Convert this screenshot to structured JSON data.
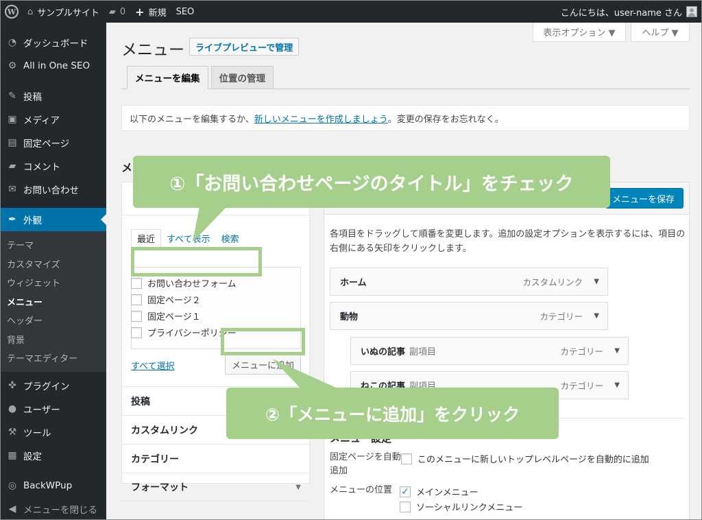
{
  "adminbar": {
    "site_name": "サンプルサイト",
    "comments_count": "0",
    "new_label": "新規",
    "seo_label": "SEO",
    "greeting": "こんにちは、user-name さん"
  },
  "sidebar": {
    "items": [
      {
        "label": "ダッシュボード",
        "icon": "dashboard-icon"
      },
      {
        "label": "All in One SEO",
        "icon": "gear-icon"
      },
      {
        "label": "投稿",
        "icon": "pin-icon"
      },
      {
        "label": "メディア",
        "icon": "media-icon"
      },
      {
        "label": "固定ページ",
        "icon": "page-icon"
      },
      {
        "label": "コメント",
        "icon": "comment-icon"
      },
      {
        "label": "お問い合わせ",
        "icon": "mail-icon"
      },
      {
        "label": "外観",
        "icon": "brush-icon"
      }
    ],
    "submenu": [
      "テーマ",
      "カスタマイズ",
      "ウィジェット",
      "メニュー",
      "ヘッダー",
      "背景",
      "テーマエディター"
    ],
    "items2": [
      {
        "label": "プラグイン",
        "icon": "plugin-icon"
      },
      {
        "label": "ユーザー",
        "icon": "user-icon"
      },
      {
        "label": "ツール",
        "icon": "wrench-icon"
      },
      {
        "label": "設定",
        "icon": "settings-icon"
      },
      {
        "label": "BackWPup",
        "icon": "backup-icon"
      },
      {
        "label": "メニューを閉じる",
        "icon": "collapse-icon"
      }
    ]
  },
  "header": {
    "screen_options": "表示オプション ▼",
    "help": "ヘルプ ▼",
    "title": "メニュー",
    "live_preview": "ライブプレビューで管理"
  },
  "tabs": [
    "メニューを編集",
    "位置の管理"
  ],
  "notice": {
    "prefix": "以下のメニューを編集するか、",
    "link": "新しいメニューを作成しましょう",
    "suffix": "。変更の保存をお忘れなく。"
  },
  "section_letter": "メ",
  "pages_panel": {
    "tabs": [
      "最近",
      "すべて表示",
      "検索"
    ],
    "items": [
      "お問い合わせフォーム",
      "固定ページ２",
      "固定ページ１",
      "プライバシーポリシー"
    ],
    "select_all": "すべて選択",
    "add_button": "メニューに追加"
  },
  "accordion": [
    "投稿",
    "カスタムリンク",
    "カテゴリー",
    "フォーマット"
  ],
  "editor": {
    "save_button": "メニューを保存",
    "help": "各項目をドラッグして順番を変更します。追加の設定オプションを表示するには、項目の右側にある矢印をクリックします。",
    "items": [
      {
        "title": "ホーム",
        "sub": "",
        "type": "カスタムリンク"
      },
      {
        "title": "動物",
        "sub": "",
        "type": "カテゴリー"
      },
      {
        "title": "いぬの記事",
        "sub": "副項目",
        "type": "カテゴリー"
      },
      {
        "title": "ねこの記事",
        "sub": "副項目",
        "type": "カテゴリー"
      }
    ],
    "settings_title": "メニュー設定",
    "auto_add_label": "固定ページを自動追加",
    "auto_add_option": "このメニューに新しいトップレベルページを自動的に追加",
    "location_label": "メニューの位置",
    "locations": [
      {
        "label": "メインメニュー",
        "checked": true
      },
      {
        "label": "ソーシャルリンクメニュー",
        "checked": false
      }
    ]
  },
  "callouts": {
    "step1": "①「お問い合わせページのタイトル」をチェック",
    "step2": "②「メニューに追加」をクリック"
  },
  "colors": {
    "adminbar": "#23282d",
    "active_menu": "#0073aa",
    "callout": "#a5cf8a",
    "primary_button": "#0085ba"
  }
}
